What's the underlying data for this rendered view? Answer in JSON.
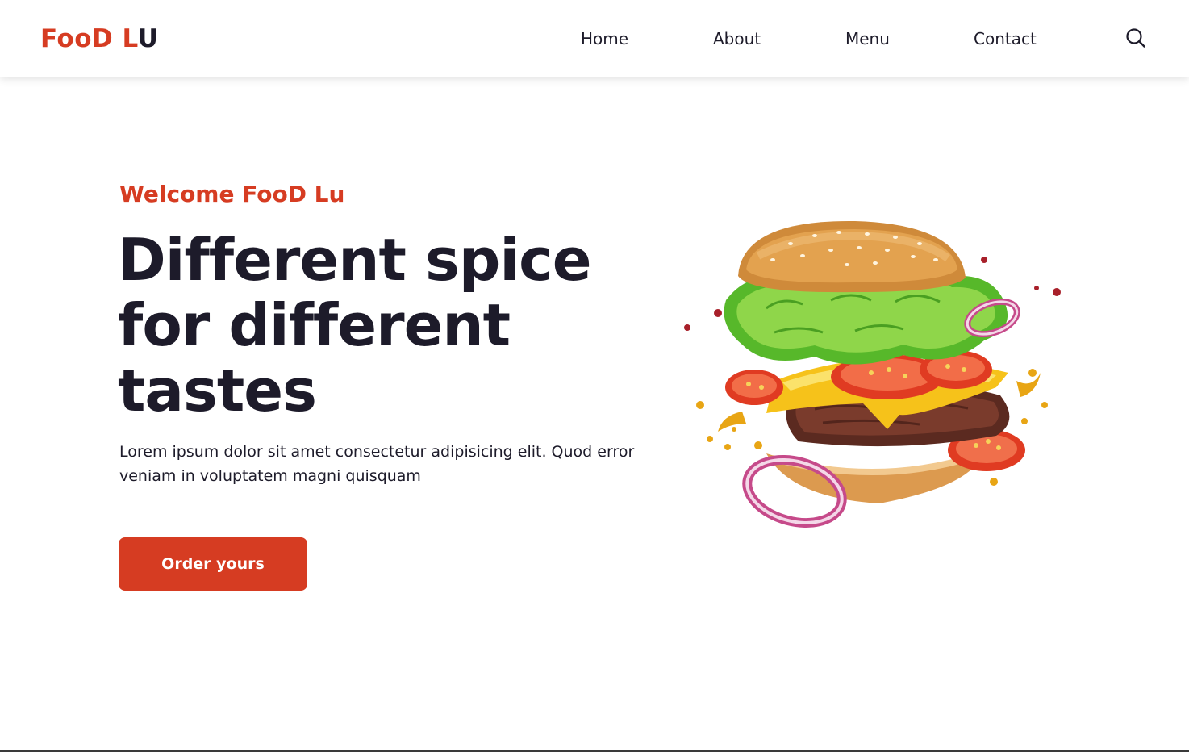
{
  "navbar": {
    "logo": {
      "part1": "Foo",
      "part2": "D",
      "part3": "L",
      "part4": "U"
    },
    "links": [
      "Home",
      "About",
      "Menu",
      "Contact"
    ],
    "search_icon": "search-icon"
  },
  "hero": {
    "subtitle": "Welcome FooD Lu",
    "title": "Different spice for different tastes",
    "description": "Lorem ipsum dolor sit amet consectetur adipisicing elit. Quod error veniam in voluptatem magni quisquam",
    "button_label": "Order yours",
    "image": "flying-burger-image"
  },
  "colors": {
    "accent": "#d63c22",
    "text": "#1d1b2a",
    "background": "#ffffff"
  }
}
